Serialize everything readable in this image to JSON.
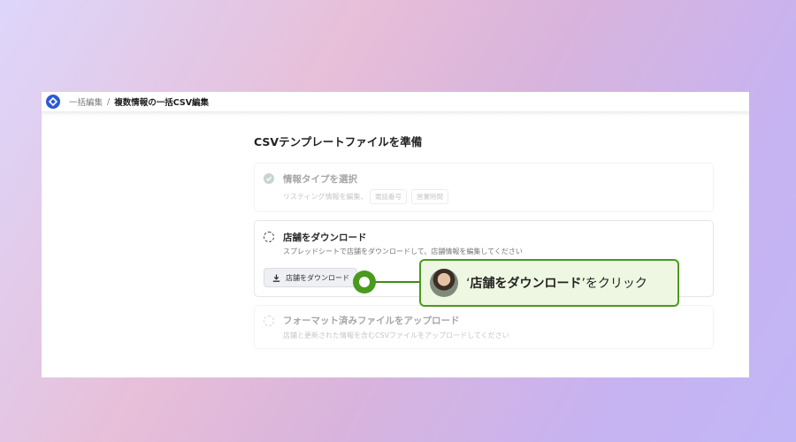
{
  "breadcrumb": {
    "parent": "一括編集",
    "separator": "/",
    "current": "複数情報の一括CSV編集"
  },
  "page": {
    "heading": "CSVテンプレートファイルを準備"
  },
  "steps": [
    {
      "title": "情報タイプを選択",
      "subtitle": "リスティング情報を編集、",
      "chips": [
        "電話番号",
        "営業時間"
      ],
      "status_icon": "check-circle-icon"
    },
    {
      "title": "店舗をダウンロード",
      "subtitle": "スプレッドシートで店舗をダウンロードして、店舗情報を編集してください",
      "button_label": "店舗をダウンロード",
      "status_icon": "dashed-circle-icon"
    },
    {
      "title": "フォーマット済みファイルをアップロード",
      "subtitle": "店舗と更新された情報を含むCSVファイルをアップロードしてください",
      "status_icon": "dashed-circle-icon"
    }
  ],
  "callout": {
    "quote_open": "‘",
    "emphasis": "店舗をダウンロード",
    "quote_close": "’",
    "suffix": "をクリック"
  },
  "colors": {
    "brand": "#2c59d6",
    "callout_green": "#4a9a1d",
    "callout_bg": "#eef7e2"
  }
}
